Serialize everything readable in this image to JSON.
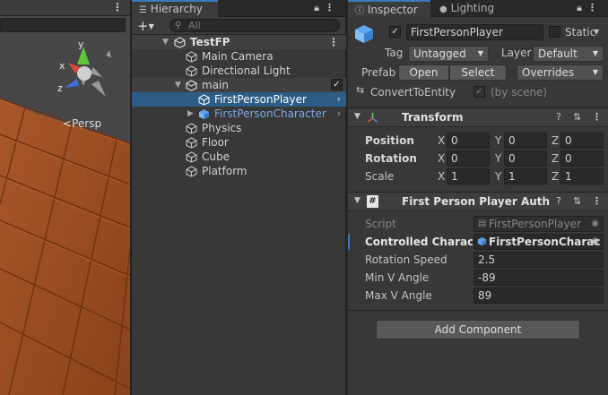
{
  "scene": {
    "persp_label": "Persp",
    "gizmo": {
      "x": "x",
      "y": "y",
      "z": "z"
    },
    "colors": {
      "floor": "#9b4e23",
      "floor_line": "#6e3414",
      "sky": "#474747"
    }
  },
  "hierarchy": {
    "tab_label": "Hierarchy",
    "add_label": "+",
    "search_placeholder": "All",
    "rows": [
      {
        "label": "TestFP",
        "kind": "scene"
      },
      {
        "label": "Main Camera"
      },
      {
        "label": "Directional Light"
      },
      {
        "label": "main",
        "kind": "subscene"
      },
      {
        "label": "FirstPersonPlayer",
        "selected": true
      },
      {
        "label": "FirstPersonCharacter",
        "prefab": true
      },
      {
        "label": "Physics"
      },
      {
        "label": "Floor"
      },
      {
        "label": "Cube"
      },
      {
        "label": "Platform"
      }
    ]
  },
  "inspector": {
    "tab_inspector": "Inspector",
    "tab_lighting": "Lighting",
    "object_name": "FirstPersonPlayer",
    "static_label": "Static",
    "tag_label": "Tag",
    "tag_value": "Untagged",
    "layer_label": "Layer",
    "layer_value": "Default",
    "prefab_label": "Prefab",
    "open_label": "Open",
    "select_label": "Select",
    "overrides_label": "Overrides",
    "convert_label": "ConvertToEntity",
    "by_scene_label": "(by scene)",
    "transform": {
      "title": "Transform",
      "position_label": "Position",
      "rotation_label": "Rotation",
      "scale_label": "Scale",
      "axis_x": "X",
      "axis_y": "Y",
      "axis_z": "Z",
      "position": [
        "0",
        "0",
        "0"
      ],
      "rotation": [
        "0",
        "0",
        "0"
      ],
      "scale": [
        "1",
        "1",
        "1"
      ]
    },
    "component": {
      "title": "First Person Player Authorin",
      "script_label": "Script",
      "script_value": "FirstPersonPlayer",
      "controlled_label": "Controlled Characte",
      "controlled_value": "FirstPersonCharac",
      "rotation_speed_label": "Rotation Speed",
      "rotation_speed_value": "2.5",
      "min_v_label": "Min V Angle",
      "min_v_value": "-89",
      "max_v_label": "Max V Angle",
      "max_v_value": "89"
    },
    "add_component_label": "Add Component"
  },
  "colors": {
    "accent": "#3a79bb",
    "selection": "#2c5d87",
    "prefab_blue": "#7ba8e5"
  }
}
